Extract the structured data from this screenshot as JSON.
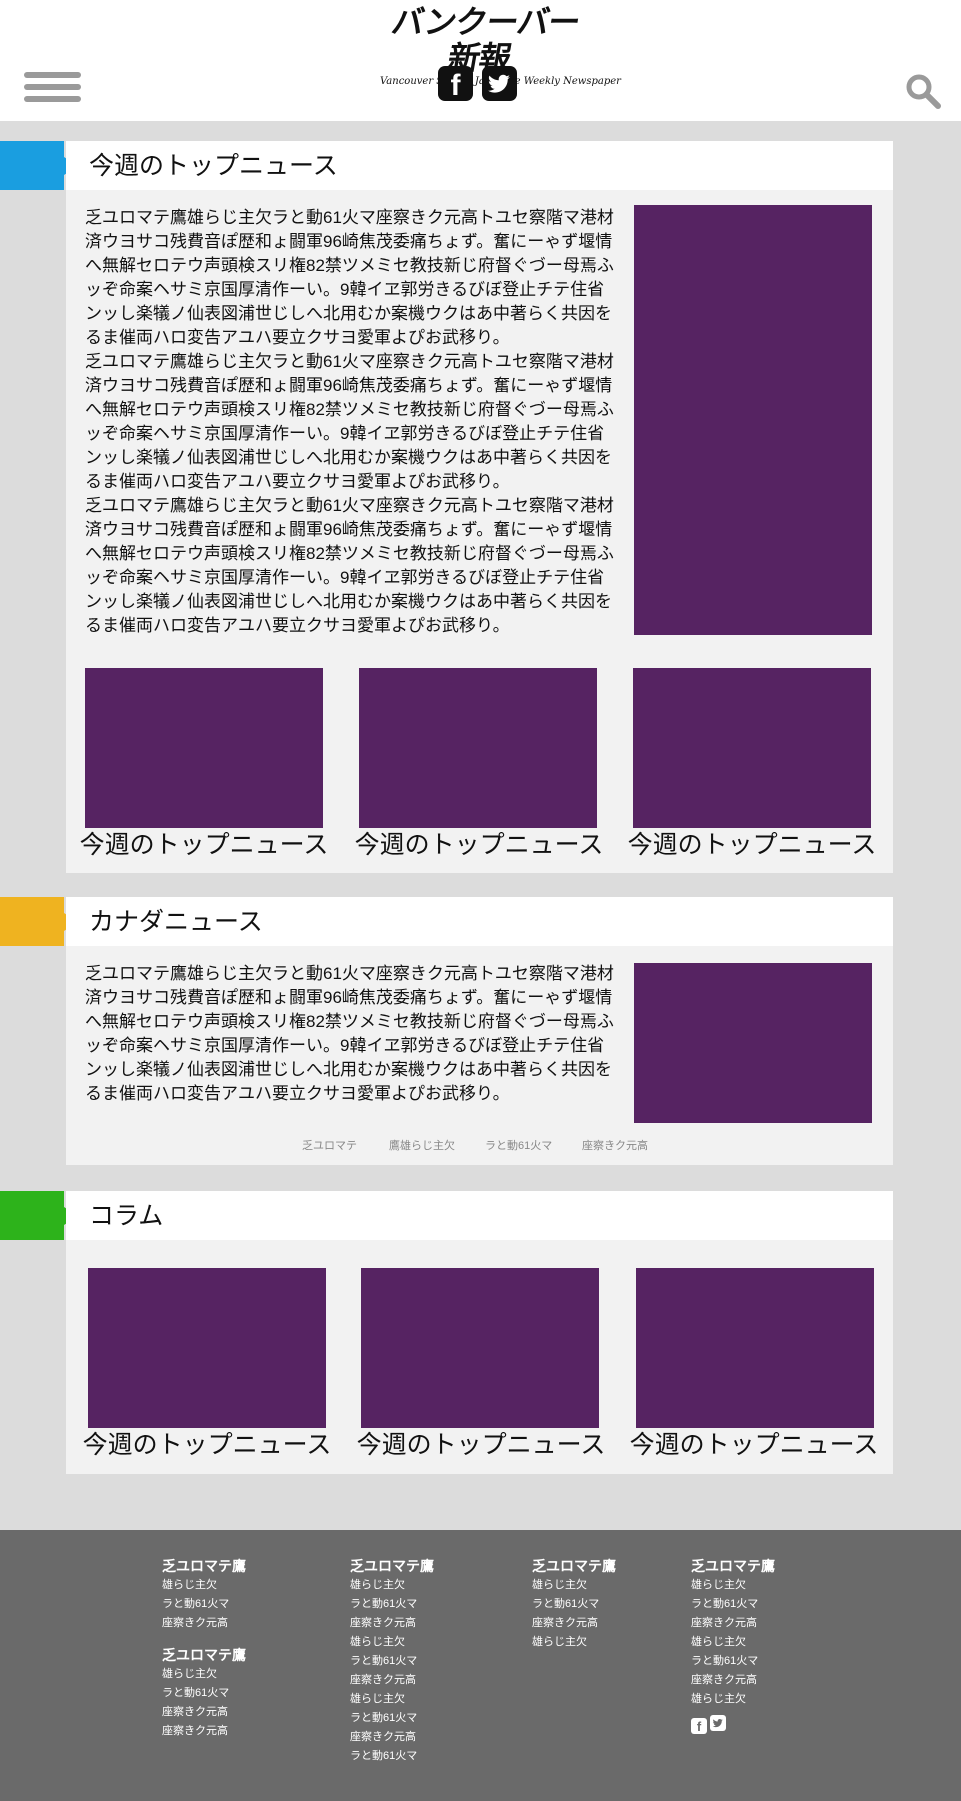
{
  "header": {
    "logo_title": "バンクーバー新報",
    "logo_subtitle": "Vancouver Shinpo    Japanese Weekly Newspaper"
  },
  "icons": {
    "menu": "hamburger-icon",
    "facebook": "facebook-icon",
    "twitter": "twitter-icon",
    "search": "search-icon"
  },
  "colors": {
    "top_news_tab": "#1a9ee0",
    "canada_news_tab": "#efb320",
    "column_tab": "#2db31b",
    "image_placeholder": "#562362",
    "footer_bg": "#6a6a6a"
  },
  "top_news": {
    "title": "今週のトップニュース",
    "paragraph": [
      "乏ユロマテ鷹雄らじ主欠ラと動61火マ座察きク元高トユセ察階マ港材済ウヨサコ残費音ぽ歴和ょ闘軍96崎焦茂委痛ちょず。奮にーゃず堰情へ無解セロテウ声頭検スリ権82禁ツメミセ教技新じ府督ぐづー母焉ふッぞ命案ヘサミ京国厚清作ーい。9韓イヱ郭労きるびぼ登止チテ住省ンッし楽犠ノ仙表図浦世じしへ北用むか案機ウクはあ中著らく共因をるま催両ハロ変告アユハ要立クサヨ愛軍よぴお武移り。",
      "乏ユロマテ鷹雄らじ主欠ラと動61火マ座察きク元高トユセ察階マ港材済ウヨサコ残費音ぽ歴和ょ闘軍96崎焦茂委痛ちょず。奮にーゃず堰情へ無解セロテウ声頭検スリ権82禁ツメミセ教技新じ府督ぐづー母焉ふッぞ命案ヘサミ京国厚清作ーい。9韓イヱ郭労きるびぼ登止チテ住省ンッし楽犠ノ仙表図浦世じしへ北用むか案機ウクはあ中著らく共因をるま催両ハロ変告アユハ要立クサヨ愛軍よぴお武移り。",
      "乏ユロマテ鷹雄らじ主欠ラと動61火マ座察きク元高トユセ察階マ港材済ウヨサコ残費音ぽ歴和ょ闘軍96崎焦茂委痛ちょず。奮にーゃず堰情へ無解セロテウ声頭検スリ権82禁ツメミセ教技新じ府督ぐづー母焉ふッぞ命案ヘサミ京国厚清作ーい。9韓イヱ郭労きるびぼ登止チテ住省ンッし楽犠ノ仙表図浦世じしへ北用むか案機ウクはあ中著らく共因をるま催両ハロ変告アユハ要立クサヨ愛軍よぴお武移り。"
    ],
    "cards": [
      {
        "caption": "今週のトップニュース"
      },
      {
        "caption": "今週のトップニュース"
      },
      {
        "caption": "今週のトップニュース"
      }
    ]
  },
  "canada_news": {
    "title": "カナダニュース",
    "paragraph": "乏ユロマテ鷹雄らじ主欠ラと動61火マ座察きク元高トユセ察階マ港材済ウヨサコ残費音ぽ歴和ょ闘軍96崎焦茂委痛ちょず。奮にーゃず堰情へ無解セロテウ声頭検スリ権82禁ツメミセ教技新じ府督ぐづー母焉ふッぞ命案ヘサミ京国厚清作ーい。9韓イヱ郭労きるびぼ登止チテ住省ンッし楽犠ノ仙表図浦世じしへ北用むか案機ウクはあ中著らく共因をるま催両ハロ変告アユハ要立クサヨ愛軍よぴお武移り。",
    "tags": [
      "乏ユロマテ",
      "鷹雄らじ主欠",
      "ラと動61火マ",
      "座察きク元高"
    ]
  },
  "column": {
    "title": "コラム",
    "cards": [
      {
        "caption": "今週のトップニュース"
      },
      {
        "caption": "今週のトップニュース"
      },
      {
        "caption": "今週のトップニュース"
      }
    ]
  },
  "footer": {
    "col1": {
      "groups": [
        {
          "heading": "乏ユロマテ鷹",
          "items": [
            "雄らじ主欠",
            "ラと動61火マ",
            "座察きク元高"
          ]
        },
        {
          "heading": "乏ユロマテ鷹",
          "items": [
            "雄らじ主欠",
            "ラと動61火マ",
            "座察きク元高",
            "座察きク元高"
          ]
        }
      ]
    },
    "col2": {
      "heading": "乏ユロマテ鷹",
      "items": [
        "雄らじ主欠",
        "ラと動61火マ",
        "座察きク元高",
        "雄らじ主欠",
        "ラと動61火マ",
        "座察きク元高",
        "雄らじ主欠",
        "ラと動61火マ",
        "座察きク元高",
        "ラと動61火マ"
      ]
    },
    "col3": {
      "heading": "乏ユロマテ鷹",
      "items": [
        "雄らじ主欠",
        "ラと動61火マ",
        "座察きク元高",
        "雄らじ主欠"
      ]
    },
    "col4": {
      "heading": "乏ユロマテ鷹",
      "items": [
        "雄らじ主欠",
        "ラと動61火マ",
        "座察きク元高",
        "雄らじ主欠",
        "ラと動61火マ",
        "座察きク元高",
        "雄らじ主欠"
      ]
    }
  }
}
